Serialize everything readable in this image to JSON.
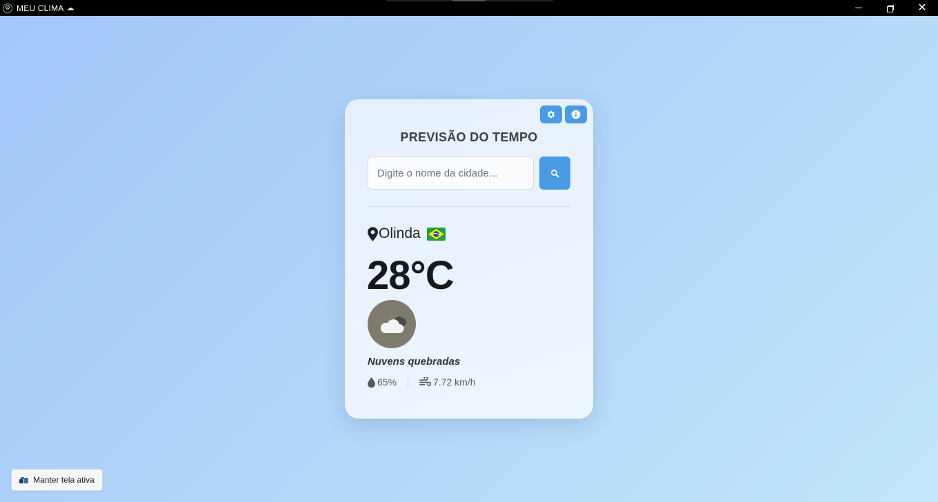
{
  "window": {
    "title": "MEU CLIMA",
    "title_icon": "cloud-icon",
    "controls": [
      "minimize-icon",
      "restore-icon",
      "close-icon"
    ]
  },
  "card": {
    "title": "PREVISÃO DO TEMPO",
    "buttons": {
      "settings_icon": "gear-icon",
      "info_icon": "info-icon"
    },
    "search": {
      "placeholder": "Digite o nome da cidade...",
      "value": "",
      "button_icon": "search-icon"
    },
    "location": {
      "icon": "map-pin-icon",
      "city": "Olinda",
      "country_flag": "brazil-flag-icon"
    },
    "temperature": "28°C",
    "weather": {
      "icon": "broken-clouds-icon",
      "description": "Nuvens quebradas"
    },
    "stats": {
      "humidity": "65%",
      "humidity_icon": "droplet-icon",
      "wind": "7.72 km/h",
      "wind_icon": "wind-icon"
    }
  },
  "footer": {
    "keep_awake_label": "Manter tela ativa",
    "keep_awake_icon": "coffee-icon"
  },
  "colors": {
    "accent": "#4a9be3",
    "background_start": "#a3c6fb",
    "background_end": "#c3e6f8",
    "card_bg": "#eaf3fd",
    "weather_icon_bg": "#7e7a6e"
  }
}
